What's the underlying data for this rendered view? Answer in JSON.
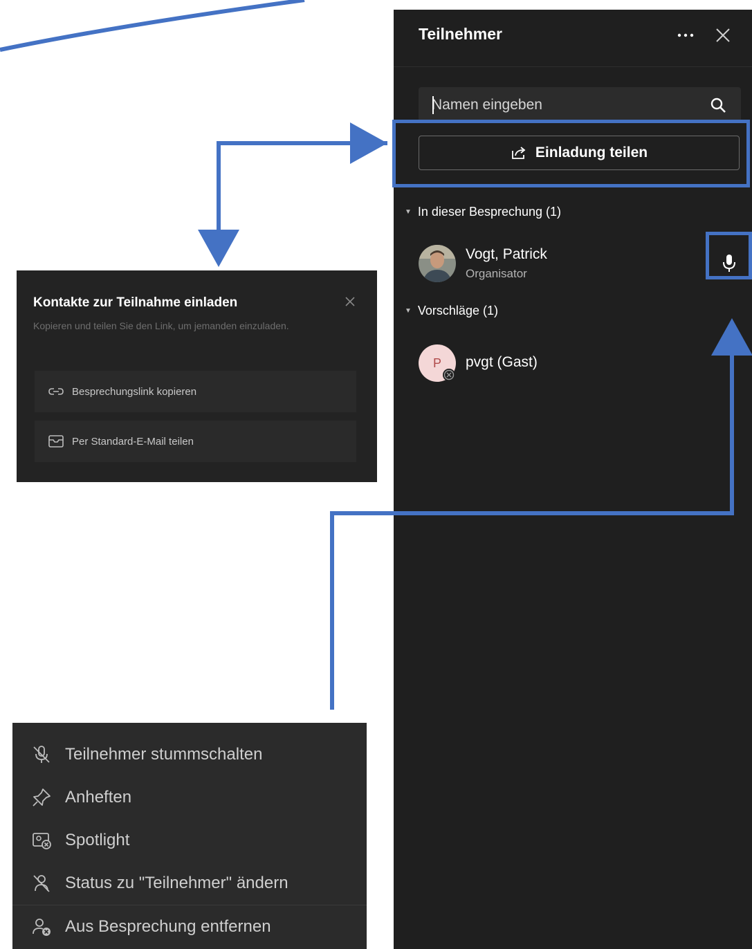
{
  "panel": {
    "title": "Teilnehmer",
    "more_icon": "more-horizontal-icon",
    "close_icon": "close-icon",
    "search": {
      "placeholder": "Namen eingeben",
      "value": "",
      "icon": "search-icon"
    },
    "invite_button": {
      "label": "Einladung teilen",
      "icon": "share-icon"
    },
    "sections": [
      {
        "label": "In dieser Besprechung (1)",
        "participants": [
          {
            "name": "Vogt, Patrick",
            "role": "Organisator",
            "avatar": "photo",
            "action_icon": "microphone-icon"
          }
        ]
      },
      {
        "label": "Vorschläge (1)",
        "participants": [
          {
            "name": "pvgt (Gast)",
            "initial": "P",
            "avatar_color": "#f4d7d7",
            "status_icon": "offline-status-icon"
          }
        ]
      }
    ]
  },
  "invite_popup": {
    "title": "Kontakte zur Teilnahme einladen",
    "description": "Kopieren und teilen Sie den Link, um jemanden einzuladen.",
    "options": [
      {
        "label": "Besprechungslink kopieren",
        "icon": "link-icon"
      },
      {
        "label": "Per Standard-E-Mail teilen",
        "icon": "mail-icon"
      }
    ]
  },
  "context_menu": {
    "items": [
      {
        "label": "Teilnehmer stummschalten",
        "icon": "mic-off-icon"
      },
      {
        "label": "Anheften",
        "icon": "pin-icon"
      },
      {
        "label": "Spotlight",
        "icon": "spotlight-icon"
      },
      {
        "label": "Status zu \"Teilnehmer\" ändern",
        "icon": "person-off-icon"
      },
      {
        "label": "Aus Besprechung entfernen",
        "icon": "person-remove-icon"
      }
    ]
  },
  "colors": {
    "callout": "#4472c4",
    "panel_bg": "#1f1f1f",
    "menu_bg": "#2b2b2b"
  }
}
